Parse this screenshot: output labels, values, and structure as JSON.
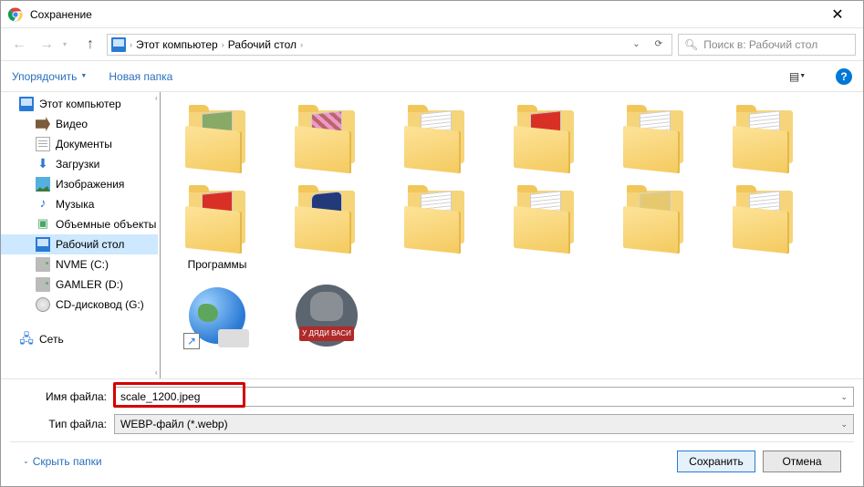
{
  "title": "Сохранение",
  "nav": {
    "crumbs": [
      "Этот компьютер",
      "Рабочий стол"
    ],
    "search_placeholder": "Поиск в: Рабочий стол"
  },
  "toolbar": {
    "organize": "Упорядочить",
    "new_folder": "Новая папка"
  },
  "sidebar": {
    "this_pc": "Этот компьютер",
    "videos": "Видео",
    "documents": "Документы",
    "downloads": "Загрузки",
    "pictures": "Изображения",
    "music": "Музыка",
    "objects3d": "Объемные объекты",
    "desktop": "Рабочий стол",
    "nvme": "NVME (C:)",
    "gamler": "GAMLER (D:)",
    "cd": "CD-дисковод (G:)",
    "network": "Сеть"
  },
  "folders": {
    "programs": "Программы",
    "uncle_vasya": "У ДЯДИ ВАСИ"
  },
  "labels": {
    "filename": "Имя файла:",
    "filetype": "Тип файла:",
    "hide_folders": "Скрыть папки",
    "save": "Сохранить",
    "cancel": "Отмена"
  },
  "values": {
    "filename": "scale_1200.jpeg",
    "filetype": "WEBP-файл (*.webp)"
  }
}
